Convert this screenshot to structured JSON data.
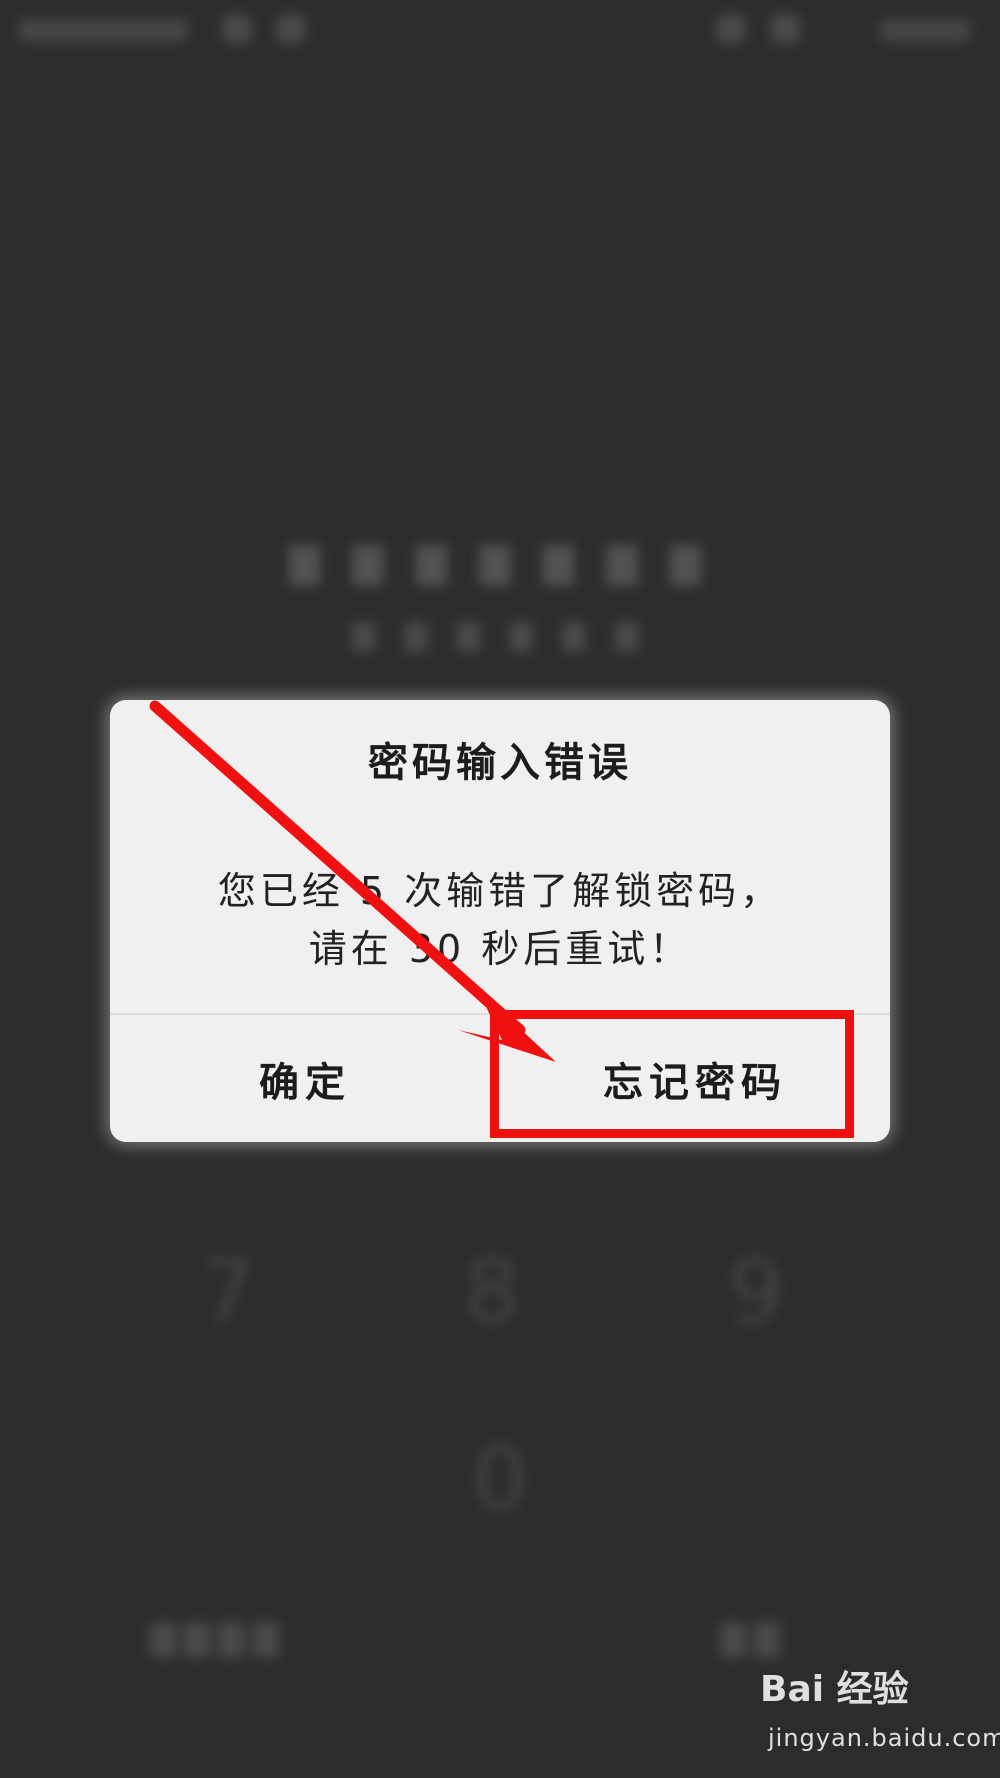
{
  "lock_screen": {
    "keypad": {
      "keys": [
        "7",
        "8",
        "9",
        "0"
      ]
    }
  },
  "dialog": {
    "title": "密码输入错误",
    "message_line1": "您已经 5 次输错了解锁密码，",
    "message_line2": "请在 30 秒后重试！",
    "confirm_label": "确定",
    "forgot_label": "忘记密码"
  },
  "annotation": {
    "color": "#f01010"
  },
  "watermark": {
    "logo": "Bai 经验",
    "url": "jingyan.baidu.com"
  }
}
